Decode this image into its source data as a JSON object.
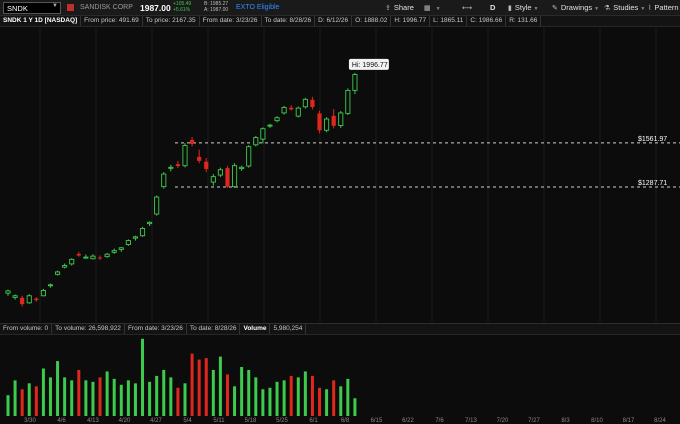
{
  "toolbar": {
    "symbol": "SNDK",
    "company": "SANDISK CORP",
    "last_price": "1987.00",
    "change_abs": "+105.49",
    "change_pct": "+5.61%",
    "bid": "B: 1985.27",
    "ask": "A: 1987.00",
    "ext_label": "EXTO Eligible",
    "share_label": "Share",
    "interval_label": "D",
    "style_label": "Style",
    "drawings_label": "Drawings",
    "studies_label": "Studies",
    "patterns_label": "Pattern",
    "colors": {
      "brand_flag": "#c0302a",
      "up": "#3ecb4d",
      "ext": "#2f8fff"
    }
  },
  "infobar": {
    "title": "SNDK 1 Y 1D [NASDAQ]",
    "from_price": "From price: 491.69",
    "to_price": "To price: 2167.35",
    "from_date": "From date: 3/23/26",
    "to_date": "To date: 8/28/26",
    "date": "D: 6/12/26",
    "open": "O: 1888.02",
    "high": "H: 1996.77",
    "low": "L: 1865.11",
    "close": "C: 1986.66",
    "range": "R: 131.66"
  },
  "price_chart": {
    "hi_label": "Hi: 1996.77",
    "level_1": "$1561.97",
    "level_2": "$1287.71",
    "colors": {
      "up": "#3ecb4d",
      "down": "#e0271d",
      "level_line": "#cfcfcf",
      "grid": "#1b1b1b"
    }
  },
  "volume": {
    "from_volume": "From volume: 0",
    "to_volume": "To volume: 26,598,922",
    "from_date": "From date: 3/23/26",
    "to_date": "To date: 8/28/26",
    "label": "Volume",
    "value": "5,980,254"
  },
  "axis": {
    "dates": [
      "3/30",
      "4/6",
      "4/13",
      "4/20",
      "4/27",
      "5/4",
      "5/11",
      "5/18",
      "5/25",
      "6/1",
      "6/8",
      "6/15",
      "6/22",
      "7/6",
      "7/13",
      "7/20",
      "7/27",
      "8/3",
      "8/10",
      "8/17",
      "8/24"
    ]
  },
  "chart_data": {
    "type": "candlestick",
    "y_range": [
      480,
      2170
    ],
    "hi_marker": 1996.77,
    "levels": [
      1561.97,
      1287.71
    ],
    "candles": [
      {
        "o": 628,
        "h": 650,
        "l": 612,
        "c": 642
      },
      {
        "o": 602,
        "h": 620,
        "l": 588,
        "c": 612
      },
      {
        "o": 600,
        "h": 612,
        "l": 545,
        "c": 560
      },
      {
        "o": 568,
        "h": 622,
        "l": 562,
        "c": 612
      },
      {
        "o": 595,
        "h": 603,
        "l": 575,
        "c": 585
      },
      {
        "o": 612,
        "h": 655,
        "l": 608,
        "c": 645
      },
      {
        "o": 675,
        "h": 688,
        "l": 662,
        "c": 680
      },
      {
        "o": 745,
        "h": 768,
        "l": 738,
        "c": 760
      },
      {
        "o": 790,
        "h": 812,
        "l": 782,
        "c": 800
      },
      {
        "o": 810,
        "h": 845,
        "l": 800,
        "c": 838
      },
      {
        "o": 872,
        "h": 885,
        "l": 855,
        "c": 862
      },
      {
        "o": 850,
        "h": 868,
        "l": 842,
        "c": 852
      },
      {
        "o": 842,
        "h": 870,
        "l": 838,
        "c": 858
      },
      {
        "o": 850,
        "h": 862,
        "l": 835,
        "c": 845
      },
      {
        "o": 855,
        "h": 878,
        "l": 848,
        "c": 870
      },
      {
        "o": 882,
        "h": 905,
        "l": 872,
        "c": 892
      },
      {
        "o": 900,
        "h": 915,
        "l": 885,
        "c": 910
      },
      {
        "o": 930,
        "h": 962,
        "l": 922,
        "c": 955
      },
      {
        "o": 970,
        "h": 985,
        "l": 955,
        "c": 978
      },
      {
        "o": 985,
        "h": 1040,
        "l": 978,
        "c": 1030
      },
      {
        "o": 1060,
        "h": 1075,
        "l": 1045,
        "c": 1068
      },
      {
        "o": 1120,
        "h": 1235,
        "l": 1110,
        "c": 1225
      },
      {
        "o": 1290,
        "h": 1380,
        "l": 1278,
        "c": 1368
      },
      {
        "o": 1405,
        "h": 1425,
        "l": 1385,
        "c": 1410
      },
      {
        "o": 1430,
        "h": 1450,
        "l": 1405,
        "c": 1418
      },
      {
        "o": 1420,
        "h": 1560,
        "l": 1410,
        "c": 1545
      },
      {
        "o": 1580,
        "h": 1598,
        "l": 1540,
        "c": 1555
      },
      {
        "o": 1475,
        "h": 1520,
        "l": 1435,
        "c": 1450
      },
      {
        "o": 1445,
        "h": 1468,
        "l": 1380,
        "c": 1400
      },
      {
        "o": 1318,
        "h": 1368,
        "l": 1296,
        "c": 1352
      },
      {
        "o": 1362,
        "h": 1408,
        "l": 1350,
        "c": 1395
      },
      {
        "o": 1405,
        "h": 1420,
        "l": 1282,
        "c": 1290
      },
      {
        "o": 1290,
        "h": 1435,
        "l": 1282,
        "c": 1420
      },
      {
        "o": 1402,
        "h": 1420,
        "l": 1388,
        "c": 1410
      },
      {
        "o": 1418,
        "h": 1548,
        "l": 1408,
        "c": 1538
      },
      {
        "o": 1550,
        "h": 1605,
        "l": 1540,
        "c": 1595
      },
      {
        "o": 1585,
        "h": 1658,
        "l": 1558,
        "c": 1650
      },
      {
        "o": 1668,
        "h": 1680,
        "l": 1655,
        "c": 1672
      },
      {
        "o": 1700,
        "h": 1728,
        "l": 1690,
        "c": 1718
      },
      {
        "o": 1748,
        "h": 1792,
        "l": 1738,
        "c": 1782
      },
      {
        "o": 1780,
        "h": 1795,
        "l": 1762,
        "c": 1770
      },
      {
        "o": 1728,
        "h": 1788,
        "l": 1720,
        "c": 1778
      },
      {
        "o": 1786,
        "h": 1842,
        "l": 1775,
        "c": 1832
      },
      {
        "o": 1830,
        "h": 1848,
        "l": 1770,
        "c": 1785
      },
      {
        "o": 1745,
        "h": 1762,
        "l": 1622,
        "c": 1640
      },
      {
        "o": 1640,
        "h": 1722,
        "l": 1628,
        "c": 1710
      },
      {
        "o": 1730,
        "h": 1772,
        "l": 1652,
        "c": 1668
      },
      {
        "o": 1670,
        "h": 1760,
        "l": 1655,
        "c": 1748
      },
      {
        "o": 1745,
        "h": 1900,
        "l": 1735,
        "c": 1888
      },
      {
        "o": 1888.02,
        "h": 1996.77,
        "l": 1865.11,
        "c": 1986.66
      }
    ],
    "volume_range": [
      0,
      26598922
    ],
    "volumes": [
      7000000,
      12000000,
      9000000,
      11000000,
      10000000,
      16000000,
      13000000,
      18500000,
      13000000,
      12000000,
      15500000,
      12000000,
      11500000,
      13000000,
      15000000,
      12500000,
      10500000,
      12000000,
      11000000,
      26000000,
      11500000,
      13500000,
      15500000,
      13000000,
      9500000,
      11000000,
      21000000,
      19000000,
      19500000,
      15500000,
      20000000,
      14000000,
      10000000,
      16500000,
      15500000,
      13000000,
      9000000,
      9500000,
      11500000,
      12000000,
      13500000,
      13000000,
      15000000,
      13500000,
      9500000,
      9000000,
      12000000,
      10000000,
      12500000,
      5980254
    ]
  }
}
